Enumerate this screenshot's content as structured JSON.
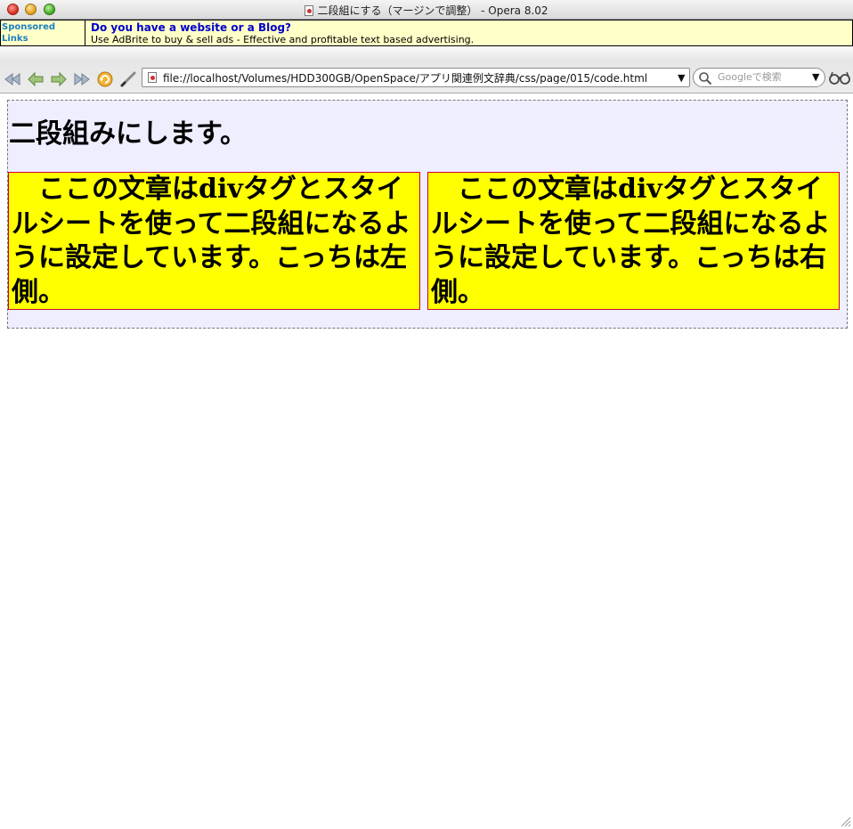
{
  "window": {
    "title": "二段組にする（マージンで調整） - Opera 8.02"
  },
  "ads": {
    "label_line1": "Sponsored",
    "label_line2": "Links",
    "headline": "Do you have a website or a Blog?",
    "description": "Use AdBrite to buy & sell ads - Effective and profitable text based advertising."
  },
  "toolbar": {
    "address": "file://localhost/Volumes/HDD300GB/OpenSpace/アプリ関連例文辞典/css/page/015/code.html",
    "search_placeholder": "Googleで検索",
    "icons": [
      "rewind-icon",
      "back-icon",
      "forward-icon",
      "fast-forward-icon",
      "reload-icon",
      "edit-pen-icon",
      "document-icon",
      "search-icon",
      "glasses-icon"
    ]
  },
  "page": {
    "heading": "二段組みにします。",
    "left_column": "ここの文章はdivタグとスタイルシートを使って二段組になるように設定しています。こっちは左側。",
    "right_column": "ここの文章はdivタグとスタイルシートを使って二段組になるように設定しています。こっちは右側。"
  },
  "colors": {
    "page_background": "#eeeeff",
    "column_background": "#ffff00",
    "column_border": "#cc0033",
    "ad_background": "#ffffc8",
    "ad_headline": "#0000cc",
    "ad_label": "#1a7fc1"
  }
}
